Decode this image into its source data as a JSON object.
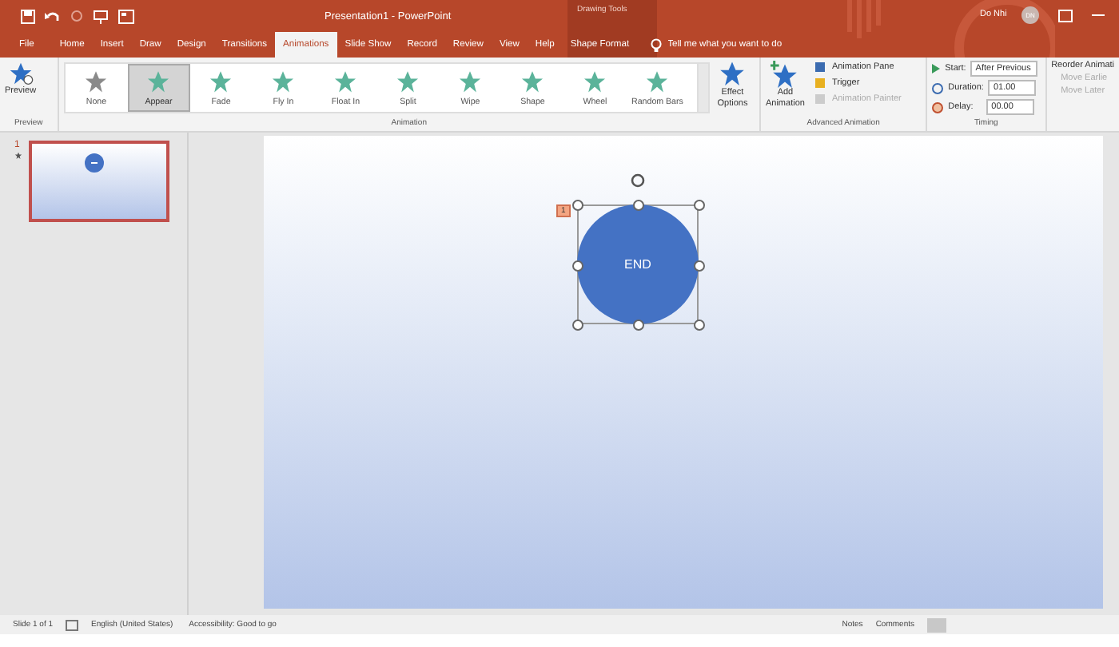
{
  "title_bar": {
    "title": "Presentation1  -  PowerPoint",
    "context_label": "Drawing Tools",
    "user_name": "Do Nhi",
    "user_initials": "DN"
  },
  "tabs": [
    {
      "label": "File",
      "selected": false
    },
    {
      "label": "Home",
      "selected": false
    },
    {
      "label": "Insert",
      "selected": false
    },
    {
      "label": "Draw",
      "selected": false
    },
    {
      "label": "Design",
      "selected": false
    },
    {
      "label": "Transitions",
      "selected": false
    },
    {
      "label": "Animations",
      "selected": true
    },
    {
      "label": "Slide Show",
      "selected": false
    },
    {
      "label": "Record",
      "selected": false
    },
    {
      "label": "Review",
      "selected": false
    },
    {
      "label": "View",
      "selected": false
    },
    {
      "label": "Help",
      "selected": false
    }
  ],
  "context_tab": {
    "label": "Shape Format",
    "selected": false
  },
  "tell_me": {
    "placeholder": "Tell me what you want to do"
  },
  "ribbon": {
    "preview": {
      "button": "Preview",
      "group": "Preview"
    },
    "gallery": [
      {
        "label": "None",
        "kind": "none",
        "selected": false
      },
      {
        "label": "Appear",
        "kind": "entrance",
        "selected": true
      },
      {
        "label": "Fade",
        "kind": "entrance",
        "selected": false
      },
      {
        "label": "Fly In",
        "kind": "entrance",
        "selected": false
      },
      {
        "label": "Float In",
        "kind": "entrance",
        "selected": false
      },
      {
        "label": "Split",
        "kind": "entrance",
        "selected": false
      },
      {
        "label": "Wipe",
        "kind": "entrance",
        "selected": false
      },
      {
        "label": "Shape",
        "kind": "entrance",
        "selected": false
      },
      {
        "label": "Wheel",
        "kind": "entrance",
        "selected": false
      },
      {
        "label": "Random Bars",
        "kind": "entrance",
        "selected": false
      }
    ],
    "effect_options": [
      "Effect",
      "Options"
    ],
    "animation_group": "Animation",
    "add_animation": [
      "Add",
      "Animation"
    ],
    "advanced": [
      {
        "label": "Animation Pane",
        "disabled": false
      },
      {
        "label": "Trigger",
        "disabled": false
      },
      {
        "label": "Animation Painter",
        "disabled": true
      }
    ],
    "advanced_group": "Advanced Animation",
    "start": {
      "label": "Start:",
      "value": "After Previous"
    },
    "duration": {
      "label": "Duration:",
      "value": "01.00"
    },
    "delay": {
      "label": "Delay:",
      "value": "00.00"
    },
    "timing_group": "Timing",
    "reorder": {
      "label": "Reorder Animati",
      "items": [
        {
          "label": "Move Earlie",
          "disabled": true
        },
        {
          "label": "Move Later",
          "disabled": true
        }
      ]
    }
  },
  "thumbnails": [
    {
      "number": "1",
      "selected": true
    }
  ],
  "slide": {
    "shape_text": "END",
    "animation_tag": "1"
  },
  "status_bar": {
    "slide": "Slide 1 of 1",
    "language": "English (United States)",
    "accessibility": "Accessibility: Good to go",
    "notes": "Notes",
    "comments": "Comments"
  }
}
